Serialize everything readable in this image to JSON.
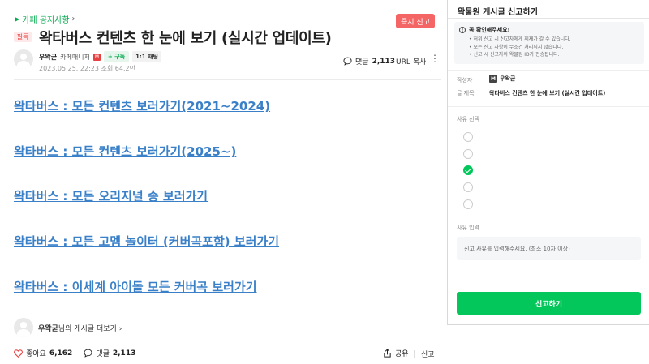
{
  "article": {
    "cafe_link": "카페 공지사항",
    "report_top_label": "즉시 신고",
    "required_badge": "필독",
    "title": "왁타버스 컨텐츠 한 눈에 보기 (실시간 업데이트)",
    "author": {
      "name": "우왁굳",
      "role": "카페매니저",
      "manager_mark": "M",
      "subscribe_label": "+ 구독",
      "chat_label": "1:1 채팅"
    },
    "date": "2023.05.25. 22:23",
    "views_label": "조회 64.2만",
    "comment_label": "댓글",
    "comment_count": "2,113",
    "url_copy_label": "URL 복사",
    "links": [
      "왁타버스 : 모든 컨텐츠 보러가기(2021~2024)",
      "왁타버스 : 모든 컨텐츠 보러가기(2025~)",
      "왁타버스 : 모든 오리지널 송 보러가기",
      "왁타버스 : 모든 고멤 놀이터 (커버곡포함) 보러가기",
      "왁타버스 : 이세계 아이돌 모든 커버곡 보러가기"
    ],
    "more_posts_name": "우왁굳",
    "more_posts_suffix": "님의 게시글 더보기",
    "like_label": "좋아요",
    "like_count": "6,162",
    "share_label": "공유",
    "report_label": "신고"
  },
  "panel": {
    "title": "왁물원 게시글 신고하기",
    "notice_head": "꼭 확인해주세요!",
    "notice_lines": [
      "• 허위 신고 시 신고자에게 제재가 갈 수 있습니다.",
      "• 모든 신고 사항이 무조건 처리되지 않습니다.",
      "• 신고 시 신고자의 왁물원 ID가 전송됩니다."
    ],
    "writer_label": "작성자",
    "writer_mark": "M",
    "writer_value": "우왁굳",
    "post_title_label": "글 제목",
    "post_title_value": "왁타버스 컨텐츠 한 눈에 보기 (실시간 업데이트)",
    "reason_label": "사유 선택",
    "reason_selected_index": 2,
    "input_label": "사유 입력",
    "input_placeholder": "신고 사유를 입력해주세요. (최소 10자 이상)",
    "submit_label": "신고하기"
  },
  "colors": {
    "brand_green": "#03c75a",
    "link_blue": "#3a80c9",
    "report_red": "#f46565"
  },
  "icons": [
    "chevron-right-icon",
    "comment-icon",
    "more-dots-icon",
    "heart-icon",
    "share-icon",
    "info-icon",
    "check-icon"
  ]
}
